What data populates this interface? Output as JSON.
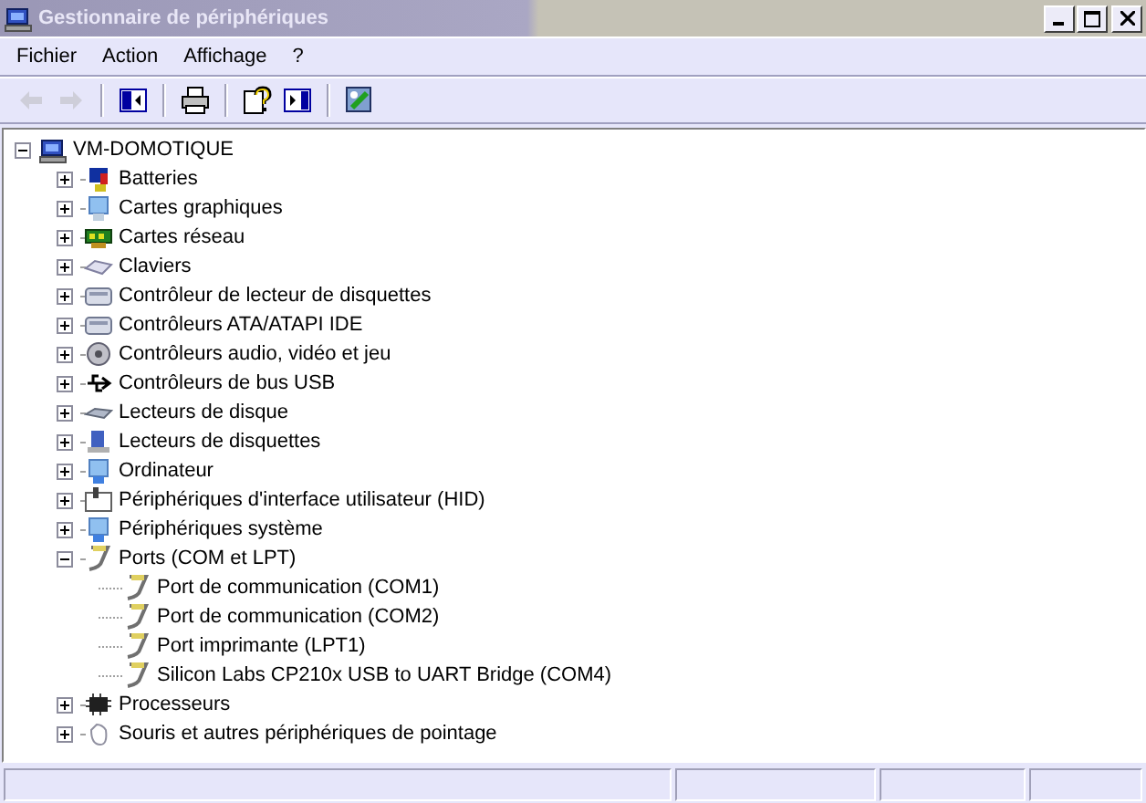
{
  "window": {
    "title": "Gestionnaire de périphériques"
  },
  "menu": [
    "Fichier",
    "Action",
    "Affichage",
    "?"
  ],
  "toolbar": [
    {
      "kind": "back",
      "disabled": true
    },
    {
      "kind": "forward",
      "disabled": true
    },
    {
      "kind": "sep"
    },
    {
      "kind": "tree",
      "disabled": false
    },
    {
      "kind": "sep"
    },
    {
      "kind": "print",
      "disabled": false
    },
    {
      "kind": "sep"
    },
    {
      "kind": "help",
      "disabled": false
    },
    {
      "kind": "pane",
      "disabled": false
    },
    {
      "kind": "sep"
    },
    {
      "kind": "scan",
      "disabled": false
    }
  ],
  "tree": {
    "label": "VM-DOMOTIQUE",
    "expanded": true,
    "children": [
      {
        "label": "Batteries",
        "expanded": false
      },
      {
        "label": "Cartes graphiques",
        "expanded": false
      },
      {
        "label": "Cartes réseau",
        "expanded": false
      },
      {
        "label": "Claviers",
        "expanded": false
      },
      {
        "label": "Contrôleur de lecteur de disquettes",
        "expanded": false
      },
      {
        "label": "Contrôleurs ATA/ATAPI IDE",
        "expanded": false
      },
      {
        "label": "Contrôleurs audio, vidéo et jeu",
        "expanded": false
      },
      {
        "label": "Contrôleurs de bus USB",
        "expanded": false
      },
      {
        "label": "Lecteurs de disque",
        "expanded": false
      },
      {
        "label": "Lecteurs de disquettes",
        "expanded": false
      },
      {
        "label": "Ordinateur",
        "expanded": false
      },
      {
        "label": "Périphériques d'interface utilisateur (HID)",
        "expanded": false
      },
      {
        "label": "Périphériques système",
        "expanded": false
      },
      {
        "label": "Ports (COM et LPT)",
        "expanded": true,
        "children": [
          {
            "label": "Port de communication (COM1)"
          },
          {
            "label": "Port de communication (COM2)"
          },
          {
            "label": "Port imprimante (LPT1)"
          },
          {
            "label": "Silicon Labs CP210x USB to UART Bridge (COM4)"
          }
        ]
      },
      {
        "label": "Processeurs",
        "expanded": false
      },
      {
        "label": "Souris et autres périphériques de pointage",
        "expanded": false
      }
    ]
  }
}
